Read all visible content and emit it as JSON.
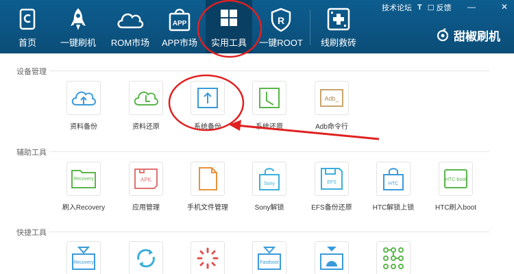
{
  "nav": {
    "items": [
      {
        "label": "首页",
        "icon": "home-icon"
      },
      {
        "label": "一键刷机",
        "icon": "rocket-icon"
      },
      {
        "label": "ROM市场",
        "icon": "cloud-icon"
      },
      {
        "label": "APP市场",
        "icon": "app-bag-icon"
      },
      {
        "label": "实用工具",
        "icon": "grid-tools-icon"
      },
      {
        "label": "一键ROOT",
        "icon": "root-shield-icon"
      },
      {
        "label": "线刷救砖",
        "icon": "brick-rescue-icon"
      }
    ]
  },
  "window": {
    "forum": "技术论坛",
    "shirt": "T",
    "feedback": "反馈",
    "minimize": "—",
    "close": "✕"
  },
  "brand": {
    "name": "甜椒刷机"
  },
  "sections": {
    "device": {
      "title": "设备管理",
      "tools": [
        {
          "label": "资料备份",
          "icon": "cloud-upload-icon",
          "color": "#3a9ad9"
        },
        {
          "label": "资料还原",
          "icon": "cloud-clock-icon",
          "color": "#5ab54a"
        },
        {
          "label": "系统备份",
          "icon": "upload-box-icon",
          "color": "#3a9ad9"
        },
        {
          "label": "系统还原",
          "icon": "clock-box-icon",
          "color": "#5ab54a"
        },
        {
          "label": "Adb命令行",
          "icon": "adb-terminal-icon",
          "color": "#c7a46a",
          "tile_text": "Adb_"
        }
      ]
    },
    "assist": {
      "title": "辅助工具",
      "tools": [
        {
          "label": "刷入Recovery",
          "icon": "recovery-folder-icon",
          "color": "#5ab54a",
          "tile_text": "Recovery"
        },
        {
          "label": "应用管理",
          "icon": "apk-folder-icon",
          "color": "#e07070",
          "tile_text": "APK"
        },
        {
          "label": "手机文件管理",
          "icon": "file-icon",
          "color": "#e8913a"
        },
        {
          "label": "Sony解锁",
          "icon": "sony-lock-icon",
          "color": "#3aaed9",
          "tile_text": "Sony"
        },
        {
          "label": "EFS备份还原",
          "icon": "efs-disk-icon",
          "color": "#3aaed9",
          "tile_text": "EFS"
        },
        {
          "label": "HTC解锁上锁",
          "icon": "htc-lock-icon",
          "color": "#3a9ad9",
          "tile_text": "HTC"
        },
        {
          "label": "HTC刷入boot",
          "icon": "htc-boot-icon",
          "color": "#5ab54a",
          "tile_text": "HTC-boot"
        }
      ]
    },
    "quick": {
      "title": "快捷工具",
      "tools": [
        {
          "label": "",
          "icon": "recovery-reboot-icon",
          "color": "#3a9ad9",
          "tile_text": "Recovery"
        },
        {
          "label": "",
          "icon": "refresh-icon",
          "color": "#3aaed9"
        },
        {
          "label": "",
          "icon": "loading-spinner-icon",
          "color": "#e05050"
        },
        {
          "label": "",
          "icon": "fastboot-icon",
          "color": "#3a9ad9",
          "tile_text": "Fastboot"
        },
        {
          "label": "",
          "icon": "android-download-icon",
          "color": "#3a9ad9"
        },
        {
          "label": "",
          "icon": "pattern-lock-icon",
          "color": "#5ab54a"
        }
      ]
    }
  },
  "colors": {
    "topbar": "#0d5d8f",
    "annotation": "#e02020"
  }
}
